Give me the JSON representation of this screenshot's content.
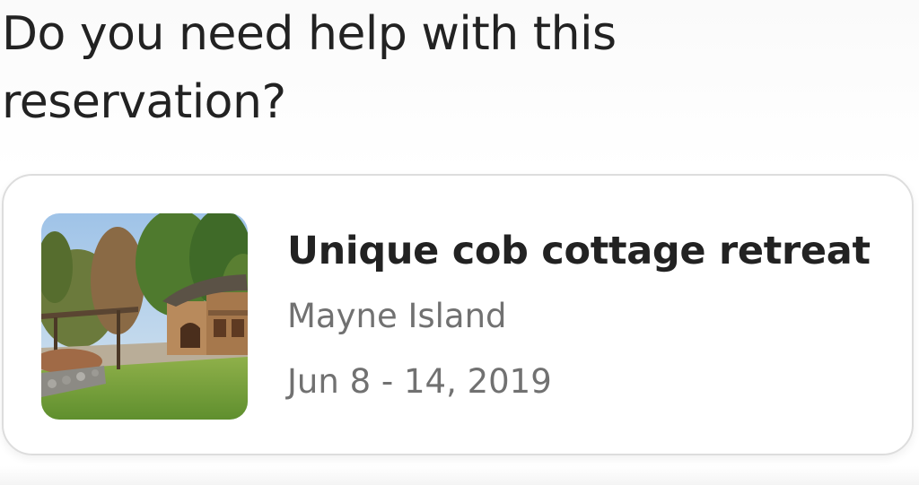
{
  "heading": {
    "line1": "Do you need help with this",
    "line2": "reservation?"
  },
  "reservation": {
    "title": "Unique cob cottage retreat",
    "location": "Mayne Island",
    "dates": "Jun 8 - 14, 2019",
    "photo_alt": "Cob cottage in a forest clearing"
  }
}
